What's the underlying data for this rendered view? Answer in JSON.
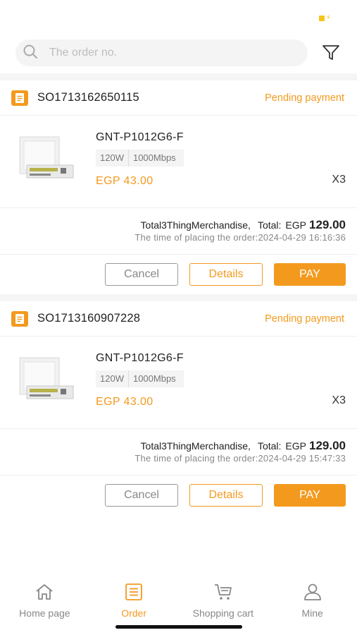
{
  "search": {
    "placeholder": "The order no."
  },
  "orders": [
    {
      "order_no": "SO1713162650115",
      "status": "Pending payment",
      "item": {
        "name": "GNT-P1012G6-F",
        "tags": [
          "120W",
          "1000Mbps"
        ],
        "price": "EGP 43.00",
        "qty": "X3"
      },
      "summary": {
        "count_text": "Total3ThingMerchandise,",
        "total_label": "Total:",
        "currency": "EGP",
        "amount": "129.00",
        "time_label": "The time of placing the order:",
        "time": "2024-04-29 16:16:36"
      },
      "actions": {
        "cancel": "Cancel",
        "details": "Details",
        "pay": "PAY"
      }
    },
    {
      "order_no": "SO1713160907228",
      "status": "Pending payment",
      "item": {
        "name": "GNT-P1012G6-F",
        "tags": [
          "120W",
          "1000Mbps"
        ],
        "price": "EGP 43.00",
        "qty": "X3"
      },
      "summary": {
        "count_text": "Total3ThingMerchandise,",
        "total_label": "Total:",
        "currency": "EGP",
        "amount": "129.00",
        "time_label": "The time of placing the order:",
        "time": "2024-04-29 15:47:33"
      },
      "actions": {
        "cancel": "Cancel",
        "details": "Details",
        "pay": "PAY"
      }
    }
  ],
  "tabbar": {
    "items": [
      {
        "label": "Home page",
        "icon": "home-icon",
        "active": false
      },
      {
        "label": "Order",
        "icon": "order-list-icon",
        "active": true
      },
      {
        "label": "Shopping cart",
        "icon": "cart-icon",
        "active": false
      },
      {
        "label": "Mine",
        "icon": "user-icon",
        "active": false
      }
    ]
  },
  "colors": {
    "accent": "#f39a1e",
    "muted": "#888888",
    "divider": "#f5f5f5"
  }
}
